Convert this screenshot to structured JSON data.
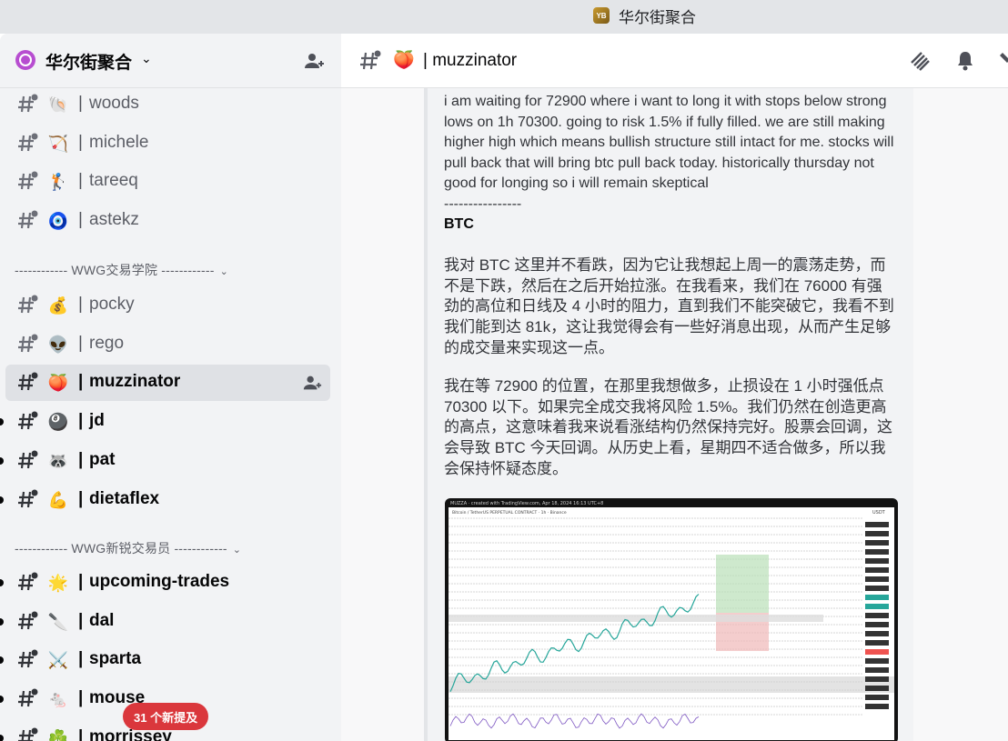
{
  "window": {
    "title": "华尔街聚合",
    "logo_text": "YB"
  },
  "server": {
    "name": "华尔街聚合"
  },
  "sidebar": {
    "channels_top": [
      {
        "emoji": "🐚",
        "name": "woods",
        "bold": false
      },
      {
        "emoji": "🏹",
        "name": "michele",
        "bold": false
      },
      {
        "emoji": "🏌️",
        "name": "tareeq",
        "bold": false
      },
      {
        "emoji": "🧿",
        "name": "astekz",
        "bold": false
      }
    ],
    "category1": "------------ WWG交易学院 ------------",
    "channels_mid": [
      {
        "emoji": "💰",
        "name": "pocky",
        "bold": false
      },
      {
        "emoji": "👽",
        "name": "rego",
        "bold": false
      },
      {
        "emoji": "🍑",
        "name": "muzzinator",
        "bold": true,
        "active": true
      },
      {
        "emoji": "🎱",
        "name": "jd",
        "bold": true
      },
      {
        "emoji": "🦝",
        "name": "pat",
        "bold": true
      },
      {
        "emoji": "💪",
        "name": "dietaflex",
        "bold": true
      }
    ],
    "category2": "------------ WWG新锐交易员 ------------",
    "channels_bottom": [
      {
        "emoji": "🌟",
        "name": "upcoming-trades",
        "bold": true
      },
      {
        "emoji": "🔪",
        "name": "dal",
        "bold": true
      },
      {
        "emoji": "⚔️",
        "name": "sparta",
        "bold": true
      },
      {
        "emoji": "🐁",
        "name": "mouse",
        "bold": true
      },
      {
        "emoji": "☘️",
        "name": "morrissey",
        "bold": true
      }
    ],
    "separator": "|",
    "new_mentions": "31 个新提及"
  },
  "channel_header": {
    "emoji": "🍑",
    "title": "| muzzinator"
  },
  "message": {
    "english": "i am waiting for 72900 where i want to long it with stops below strong lows on 1h 70300. going to risk 1.5% if fully filled. we are still making higher high which means bullish structure still intact for me. stocks will pull back that will bring btc pull back today. historically thursday not good for longing so i will remain skeptical\n----------------",
    "btc_label": "BTC",
    "chinese_1": "我对 BTC 这里并不看跌，因为它让我想起上周一的震荡走势，而不是下跌，然后在之后开始拉涨。在我看来，我们在 76000 有强劲的高位和日线及 4 小时的阻力，直到我们不能突破它，我看不到我们能到达 81k，这让我觉得会有一些好消息出现，从而产生足够的成交量来实现这一点。",
    "chinese_2": "我在等 72900 的位置，在那里我想做多，止损设在 1 小时强低点 70300 以下。如果完全成交我将风险 1.5%。我们仍然在创造更高的高点，这意味着我来说看涨结构仍然保持完好。股票会回调，这会导致 BTC 今天回调。从历史上看，星期四不适合做多，所以我会保持怀疑态度。"
  },
  "attachment": {
    "caption": "MUZZA · created with TradingView.com, Apr 18, 2024 16:13 UTC+8",
    "symbol": "Bitcoin / TetherUS PERPETUAL CONTRACT · 1h · Binance",
    "currency": "USDT"
  },
  "colors": {
    "accent_red": "#da373c",
    "bg_sidebar": "#f2f3f5"
  }
}
